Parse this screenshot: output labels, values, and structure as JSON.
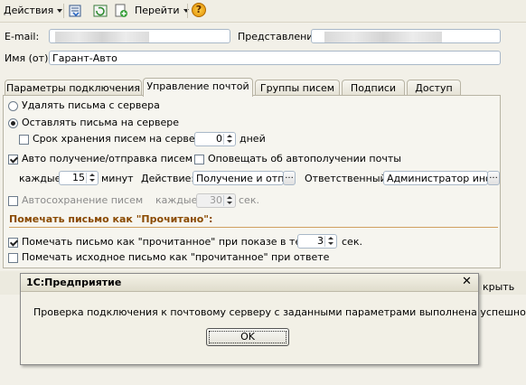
{
  "toolbar": {
    "actions_label": "Действия",
    "goto_label": "Перейти",
    "help_icon": "?"
  },
  "form": {
    "email_label": "E-mail:",
    "representation_label": "Представление",
    "name_label": "Имя (от):",
    "name_value": "Гарант-Авто"
  },
  "tabs": [
    {
      "label": "Параметры подключения"
    },
    {
      "label": "Управление почтой"
    },
    {
      "label": "Группы писем"
    },
    {
      "label": "Подписи"
    },
    {
      "label": "Доступ"
    }
  ],
  "panel": {
    "delete_radio": "Удалять письма с сервера",
    "keep_radio": "Оставлять письма на сервере",
    "storage_term_label": "Срок хранения писем на сервере:",
    "storage_term_value": "0",
    "days_label": "дней",
    "auto_label": "Авто получение/отправка писем",
    "notify_label": "Оповещать об автополучении почты",
    "every_label": "каждые",
    "every_value": "15",
    "minutes_label": "минут",
    "action_label": "Действие:",
    "action_value": "Получение и отпра",
    "responsible_label": "Ответственный:",
    "responsible_value": "Администратор инфо",
    "autosave_label": "Автосохранение писем",
    "autosave_every": "каждые",
    "autosave_value": "30",
    "sec_label": "сек.",
    "mark_section": "Помечать письмо как \"Прочитано\":",
    "mark_show_label": "Помечать письмо как \"прочитанное\" при показе в течении",
    "mark_show_value": "3",
    "mark_sec": "сек.",
    "mark_reply_label": "Помечать исходное письмо  как \"прочитанное\" при ответе"
  },
  "bottom_partial": {
    "right_text": "крыть"
  },
  "dialog": {
    "title": "1С:Предприятие",
    "close": "✕",
    "message": "Проверка подключения к почтовому серверу с заданными параметрами выполнена успешно.",
    "ok_label": "OK"
  }
}
